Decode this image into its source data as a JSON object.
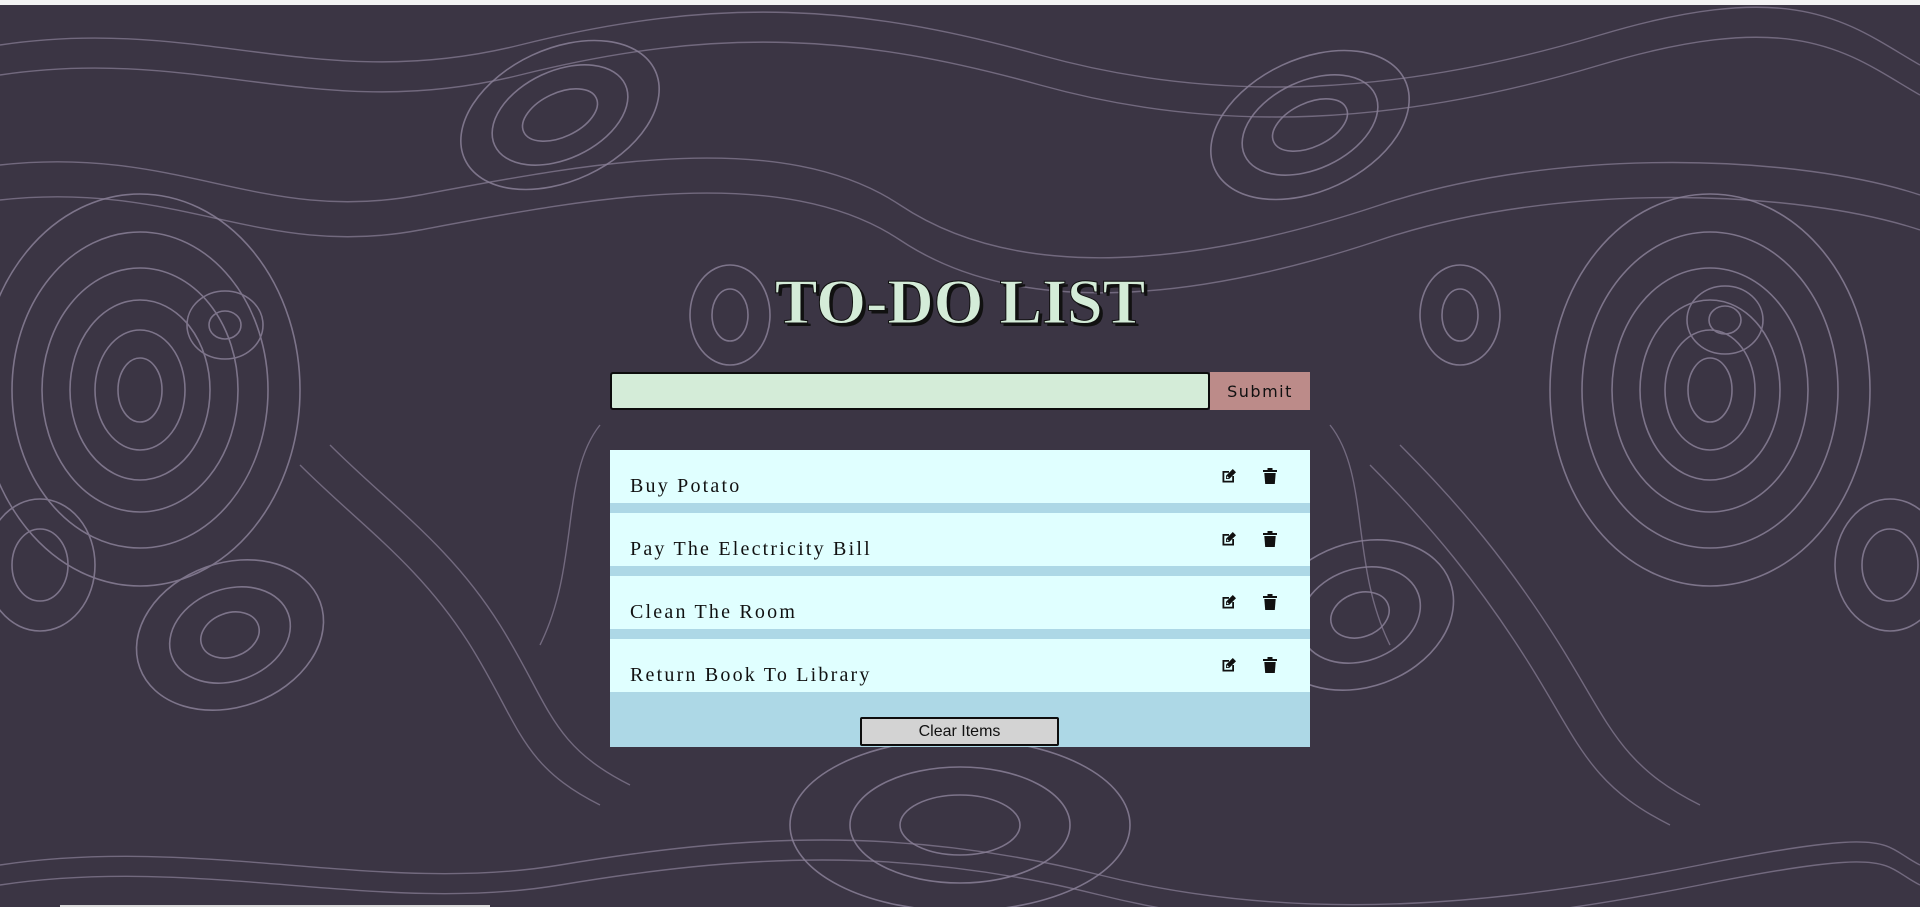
{
  "app": {
    "title": "TO-DO LIST"
  },
  "form": {
    "input_value": "",
    "input_placeholder": "",
    "submit_label": "Submit"
  },
  "items": [
    {
      "text": "Buy Potato",
      "edit_icon": "edit-icon",
      "delete_icon": "trash-icon"
    },
    {
      "text": "Pay The Electricity Bill",
      "edit_icon": "edit-icon",
      "delete_icon": "trash-icon"
    },
    {
      "text": "Clean The Room",
      "edit_icon": "edit-icon",
      "delete_icon": "trash-icon"
    },
    {
      "text": "Return Book To Library",
      "edit_icon": "edit-icon",
      "delete_icon": "trash-icon"
    }
  ],
  "actions": {
    "clear_label": "Clear Items"
  },
  "colors": {
    "background": "#3b3544",
    "pattern_line": "#8a8098",
    "title_fill": "#d4ecd8",
    "input_fill": "#d4ecd8",
    "submit_fill": "#bc8b89",
    "item_fill": "#e0ffff",
    "panel_fill": "#add8e6",
    "clear_fill": "#d3d3d3"
  }
}
